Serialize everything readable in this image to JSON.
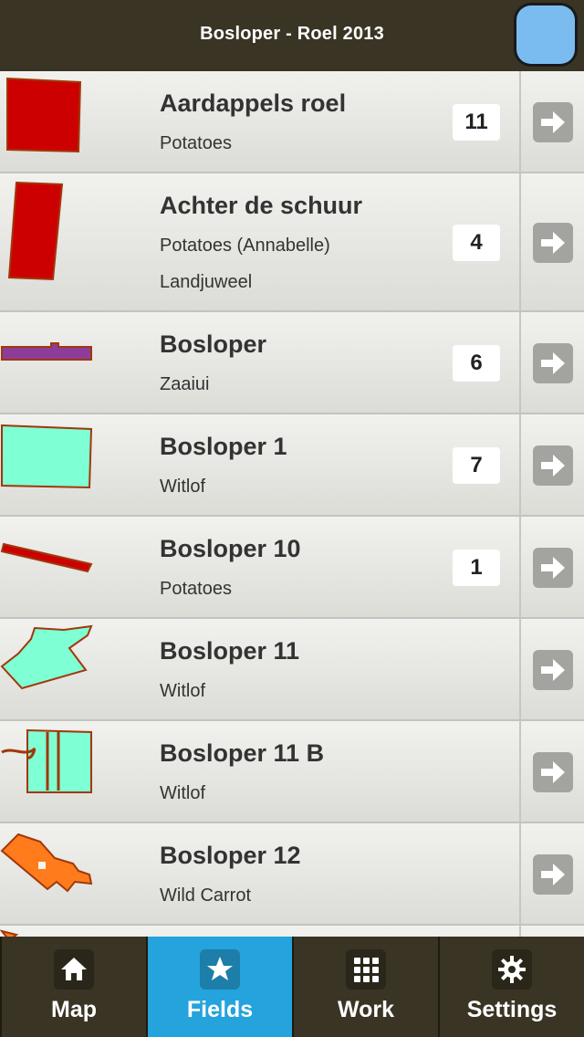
{
  "header": {
    "title": "Bosloper - Roel 2013"
  },
  "fields": [
    {
      "name": "Aardappels roel",
      "lines": [
        "Potatoes"
      ],
      "count": "11",
      "color": "#cc0000"
    },
    {
      "name": "Achter de schuur",
      "lines": [
        "Potatoes (Annabelle)",
        "Landjuweel"
      ],
      "count": "4",
      "color": "#cc0000"
    },
    {
      "name": "Bosloper",
      "lines": [
        "Zaaiui"
      ],
      "count": "6",
      "color": "#8e3c9a"
    },
    {
      "name": "Bosloper 1",
      "lines": [
        "Witlof"
      ],
      "count": "7",
      "color": "#7fffd4"
    },
    {
      "name": "Bosloper 10",
      "lines": [
        "Potatoes"
      ],
      "count": "1",
      "color": "#cc0000"
    },
    {
      "name": "Bosloper 11",
      "lines": [
        "Witlof"
      ],
      "count": "",
      "color": "#7fffd4"
    },
    {
      "name": "Bosloper 11 B",
      "lines": [
        "Witlof"
      ],
      "count": "",
      "color": "#7fffd4"
    },
    {
      "name": "Bosloper 12",
      "lines": [
        "Wild Carrot"
      ],
      "count": "",
      "color": "#ff7b1c"
    }
  ],
  "tabs": [
    {
      "label": "Map",
      "icon": "home-icon"
    },
    {
      "label": "Fields",
      "icon": "star-icon"
    },
    {
      "label": "Work",
      "icon": "grid-icon"
    },
    {
      "label": "Settings",
      "icon": "gear-icon"
    }
  ],
  "colors": {
    "header": "#3a3424",
    "active_tab": "#24a3dd",
    "outline": "#a0380a"
  }
}
